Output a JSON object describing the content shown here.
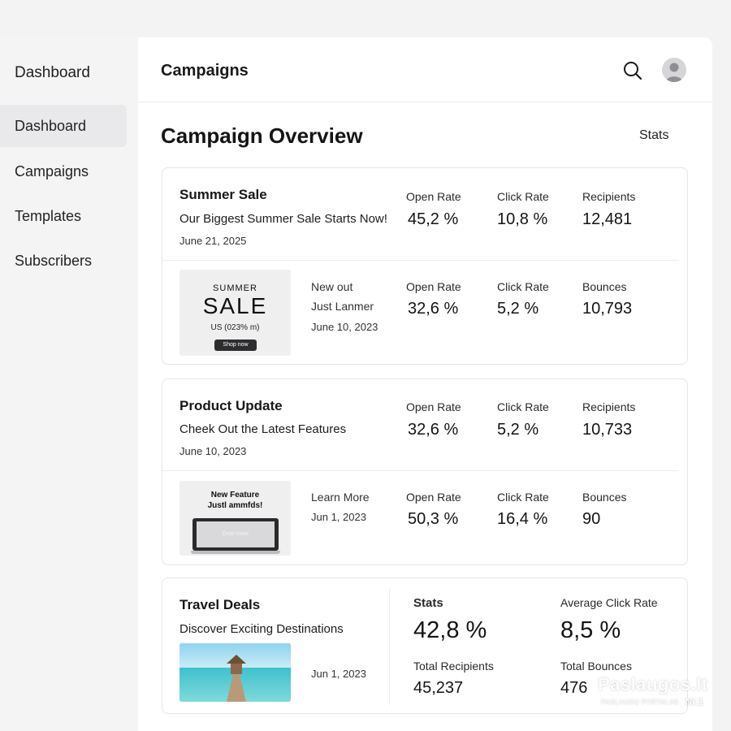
{
  "sidebar": {
    "title": "Dashboard",
    "items": [
      {
        "label": "Dashboard"
      },
      {
        "label": "Campaigns"
      },
      {
        "label": "Templates"
      },
      {
        "label": "Subscribers"
      }
    ]
  },
  "header": {
    "title": "Campaigns",
    "search_icon": "search-icon",
    "avatar_icon": "user-avatar-icon"
  },
  "overview": {
    "title": "Campaign Overview",
    "stats_link": "Stats"
  },
  "campaigns": [
    {
      "title": "Summer Sale",
      "subtitle": "Our Biggest Summer Sale Starts Now!",
      "date": "June 21, 2025",
      "metrics": [
        {
          "label": "Open Rate",
          "value": "45,2 %"
        },
        {
          "label": "Click Rate",
          "value": "10,8 %"
        },
        {
          "label": "Recipients",
          "value": "12,481"
        }
      ],
      "sub": {
        "thumb": {
          "line1": "SUMMER",
          "line2": "SALE",
          "line3": "US (023% m)",
          "button": "Shop now"
        },
        "line1": "New out",
        "line2": "Just Lanmer",
        "date": "June 10, 2023",
        "metrics": [
          {
            "label": "Open Rate",
            "value": "32,6 %"
          },
          {
            "label": "Click Rate",
            "value": "5,2 %"
          },
          {
            "label": "Bounces",
            "value": "10,793"
          }
        ]
      }
    },
    {
      "title": "Product Update",
      "subtitle": "Cheek Out the Latest Features",
      "date": "June 10, 2023",
      "metrics": [
        {
          "label": "Open Rate",
          "value": "32,6 %"
        },
        {
          "label": "Click Rate",
          "value": "5,2 %"
        },
        {
          "label": "Recipients",
          "value": "10,733"
        }
      ],
      "sub": {
        "thumb": {
          "line1": "New Feature",
          "line2": "Justl ammfds!",
          "screen_text": "Dust more"
        },
        "line1": "Learn More",
        "date": "Jun 1, 2023",
        "metrics": [
          {
            "label": "Open Rate",
            "value": "50,3 %"
          },
          {
            "label": "Click Rate",
            "value": "16,4 %"
          },
          {
            "label": "Bounces",
            "value": "90"
          }
        ]
      }
    },
    {
      "title": "Travel Deals",
      "subtitle": "Discover Exciting Destinations",
      "date": "Jun 1, 2023",
      "stats": {
        "stats_label": "Stats",
        "stats_value": "42,8 %",
        "avg_click_label": "Average Click Rate",
        "avg_click_value": "8,5 %",
        "total_recipients_label": "Total Recipients",
        "total_recipients_value": "45,237",
        "total_bounces_label": "Total Bounces",
        "total_bounces_value": "476"
      }
    }
  ],
  "watermark": {
    "brand": "Paslaugos.lt",
    "tagline": "PASLAUGŲ PORTALAS",
    "badge": "Nr.1"
  }
}
